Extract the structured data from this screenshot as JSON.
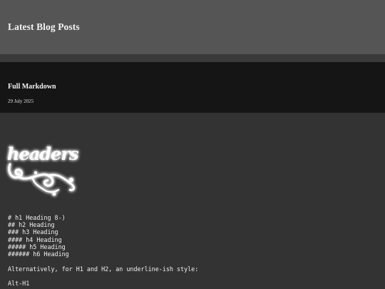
{
  "header": {
    "site_title": "Latest Blog Posts"
  },
  "post": {
    "title": "Full Markdown",
    "date": "29 July 2025"
  },
  "image": {
    "text": "headers"
  },
  "content": {
    "heading_lines": [
      "# h1 Heading 8-)",
      "## h2 Heading",
      "### h3 Heading",
      "#### h4 Heading",
      "##### h5 Heading",
      "###### h6 Heading"
    ],
    "alt_note": "Alternatively, for H1 and H2, an underline-ish style:",
    "alt_h1": "Alt-H1"
  },
  "colors": {
    "header_bg": "#555555",
    "post_header_bg": "#151515",
    "body_bg": "#333333",
    "text": "#f0f0f0"
  }
}
